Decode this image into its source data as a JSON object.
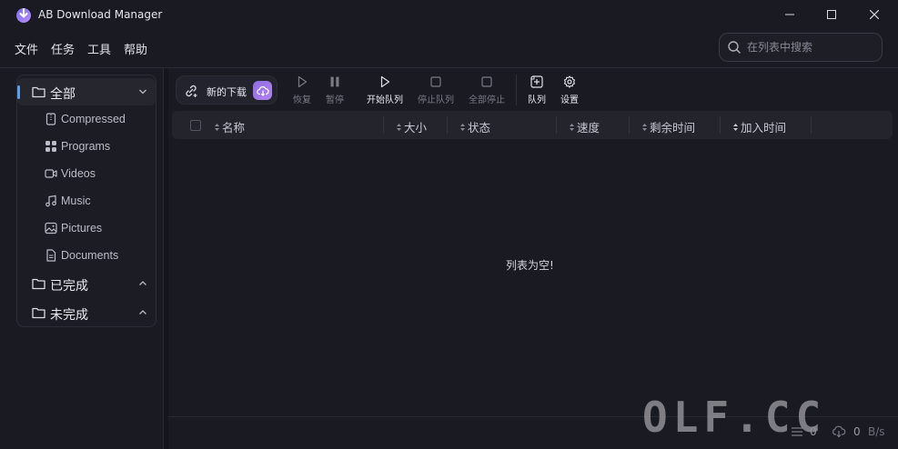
{
  "window": {
    "title": "AB Download Manager",
    "icons": {
      "logo": "ab-logo-icon",
      "minimize": "minimize-icon",
      "maximize": "maximize-icon",
      "close": "close-icon"
    }
  },
  "menu": [
    "文件",
    "任务",
    "工具",
    "帮助"
  ],
  "search": {
    "placeholder": "在列表中搜索",
    "icon": "search-icon"
  },
  "sidebar": {
    "categories": [
      {
        "label": "全部",
        "active": true,
        "expanded": true,
        "children": [
          {
            "label": "Compressed",
            "icon": "archive-icon"
          },
          {
            "label": "Programs",
            "icon": "grid-icon"
          },
          {
            "label": "Videos",
            "icon": "video-icon"
          },
          {
            "label": "Music",
            "icon": "music-icon"
          },
          {
            "label": "Pictures",
            "icon": "picture-icon"
          },
          {
            "label": "Documents",
            "icon": "document-icon"
          }
        ]
      },
      {
        "label": "已完成",
        "active": false,
        "expanded": false
      },
      {
        "label": "未完成",
        "active": false,
        "expanded": false
      }
    ]
  },
  "toolbar": {
    "new_download": "新的下载",
    "buttons": [
      {
        "label": "恢复",
        "icon": "play-icon",
        "enabled": false
      },
      {
        "label": "暂停",
        "icon": "pause-icon",
        "enabled": false
      },
      {
        "label": "开始队列",
        "icon": "play-icon",
        "enabled": true
      },
      {
        "label": "停止队列",
        "icon": "stop-icon",
        "enabled": false
      },
      {
        "label": "全部停止",
        "icon": "stop-icon",
        "enabled": false
      },
      {
        "label": "队列",
        "icon": "queue-icon",
        "enabled": true
      },
      {
        "label": "设置",
        "icon": "gear-icon",
        "enabled": true
      }
    ]
  },
  "table": {
    "columns": [
      "名称",
      "大小",
      "状态",
      "速度",
      "剩余时间",
      "加入时间"
    ],
    "empty_message": "列表为空!"
  },
  "status": {
    "active_count": "0",
    "speed_value": "0",
    "speed_unit": "B/s"
  },
  "watermark": "OLF.CC",
  "colors": {
    "background": "#1a1a22",
    "accent": "#5d9dea",
    "new_download_button": "#a77be8"
  }
}
